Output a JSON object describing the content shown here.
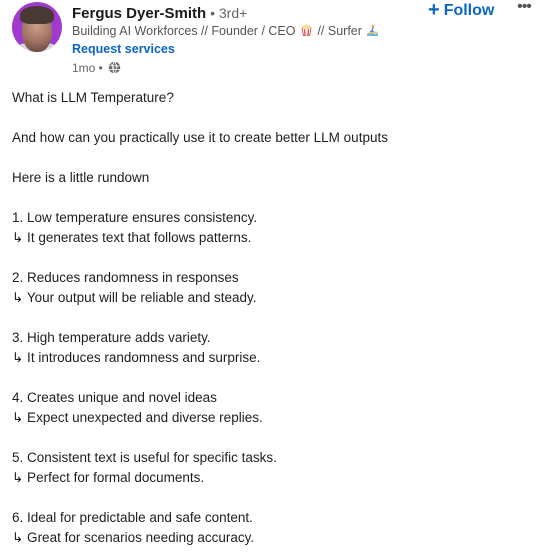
{
  "author": {
    "name": "Fergus Dyer-Smith",
    "separator": " • ",
    "degree": "3rd+",
    "headline_part1": "Building AI Workforces // Founder / CEO",
    "headline_part2": "// Surfer",
    "headline_emoji1": "popcorn-icon",
    "headline_emoji2": "surfer-icon",
    "request_services": "Request services",
    "time": "1mo",
    "time_separator": " • ",
    "visibility_icon": "globe-icon"
  },
  "actions": {
    "follow_plus": "+",
    "follow_label": "Follow",
    "more_label": "•••"
  },
  "colors": {
    "link_blue": "#0a66c2",
    "text_primary": "#1f1f1f",
    "text_secondary": "#666666",
    "avatar_bg": "#a13bd0"
  },
  "post": {
    "intro": [
      "What is LLM Temperature?",
      "And how can you practically use it to create better LLM outputs",
      "Here is a little rundown"
    ],
    "points": [
      {
        "title": "1. Low temperature ensures consistency.",
        "detail": "↳ It generates text that follows patterns."
      },
      {
        "title": "2. Reduces randomness in responses",
        "detail": "↳ Your output will be reliable and steady."
      },
      {
        "title": "3. High temperature adds variety.",
        "detail": "↳ It introduces randomness and surprise."
      },
      {
        "title": "4. Creates unique and novel ideas",
        "detail": "↳ Expect unexpected and diverse replies."
      },
      {
        "title": "5. Consistent text is useful for specific tasks.",
        "detail": "↳ Perfect for formal documents."
      },
      {
        "title": "6. Ideal for predictable and safe content.",
        "detail": "↳ Great for scenarios needing accuracy."
      }
    ]
  }
}
